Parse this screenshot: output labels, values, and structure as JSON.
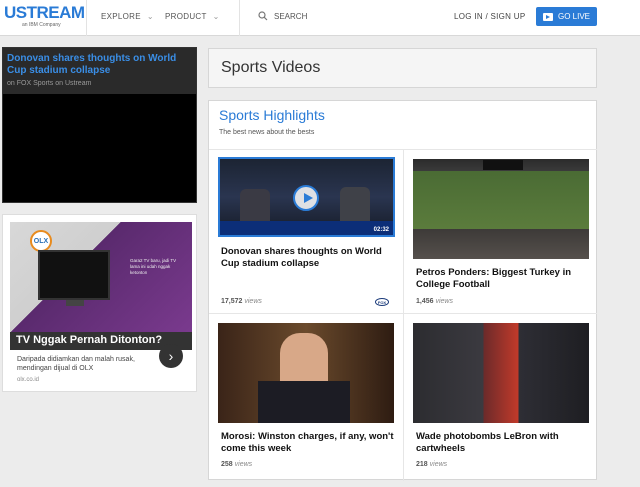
{
  "header": {
    "logo_text": "USTREAM",
    "logo_sub": "an IBM Company",
    "nav": [
      {
        "label": "EXPLORE"
      },
      {
        "label": "PRODUCT"
      }
    ],
    "search_label": "SEARCH",
    "login_label": "LOG IN / SIGN UP",
    "golive_label": "GO LIVE",
    "accent_color": "#2a7bd6"
  },
  "player": {
    "title": "Donovan shares thoughts on World Cup stadium collapse",
    "subtitle": "on FOX Sports on Ustream"
  },
  "ad": {
    "brand": "OLX",
    "bubble_text": "Gara2 TV baru, jadi TV lama ini udah nggak ketonton",
    "headline": "TV Nggak Pernah Ditonton?",
    "description": "Daripada didiamkan dan malah rusak, mendingan dijual di OLX",
    "domain": "olx.co.id"
  },
  "main": {
    "category_title": "Sports Videos",
    "highlights_title": "Sports Highlights",
    "highlights_sub": "The best news about the bests",
    "views_word": "views",
    "videos": [
      {
        "title": "Donovan shares thoughts on World Cup stadium collapse",
        "views": "17,572",
        "duration": "02:32",
        "channel_logo": "FOX"
      },
      {
        "title": "Petros Ponders: Biggest Turkey in College Football",
        "views": "1,456"
      },
      {
        "title": "Morosi: Winston charges, if any, won't come this week",
        "views": "258"
      },
      {
        "title": "Wade photobombs LeBron with cartwheels",
        "views": "218"
      }
    ]
  }
}
